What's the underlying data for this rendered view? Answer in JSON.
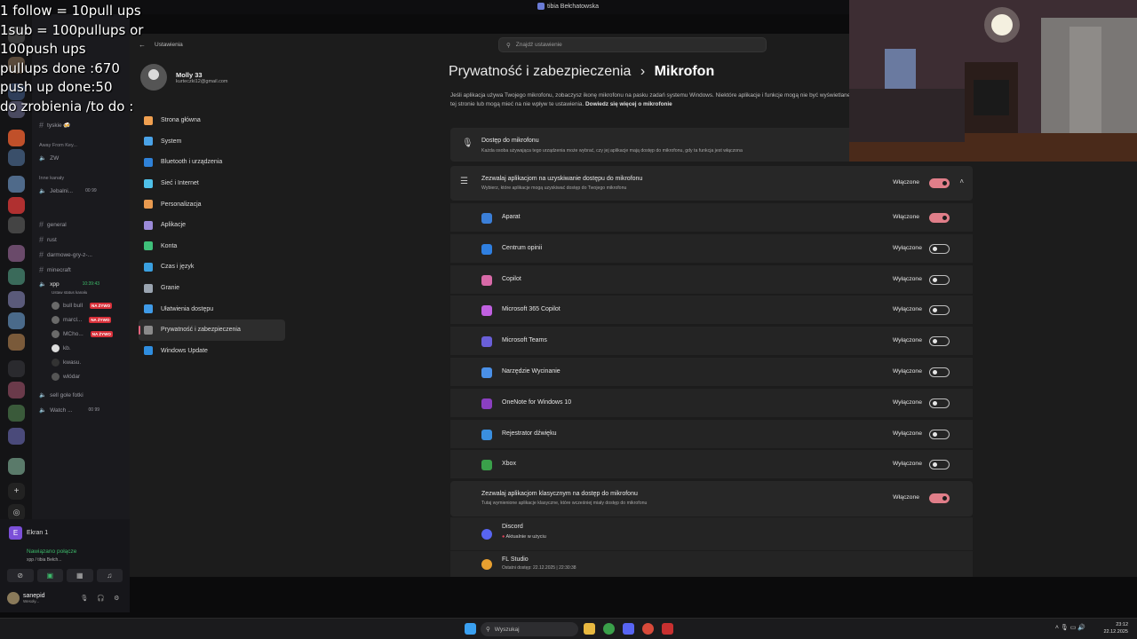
{
  "window_title": "tibia Bełchatowska",
  "overlay_lines": [
    "1 follow = 10pull ups",
    "1sub = 100pullups or",
    "100push ups",
    "pullups done :670",
    "push up done:50",
    "do zrobienia /to do :"
  ],
  "discord": {
    "channels": [
      {
        "label": "tyskie 🍻",
        "type": "text"
      },
      {
        "label": "Away From Key...",
        "type": "header"
      },
      {
        "label": "ZW",
        "type": "voice"
      },
      {
        "label": "Inne kanały",
        "type": "header"
      },
      {
        "label": "Jebalni...",
        "type": "voice",
        "extra": "00 99"
      },
      {
        "label": "general",
        "type": "text"
      },
      {
        "label": "rust",
        "type": "text"
      },
      {
        "label": "darmowe-gry-z-...",
        "type": "text"
      },
      {
        "label": "minecraft",
        "type": "text"
      },
      {
        "label": "xpp",
        "type": "voice",
        "extra": "10:39:43",
        "status": "Ustaw status kanału"
      },
      {
        "label": "sell gole fotki",
        "type": "voice"
      },
      {
        "label": "Watch ...",
        "type": "voice",
        "extra": "00 99"
      }
    ],
    "voice_users": [
      {
        "name": "bull bull",
        "live": "NA ŻYWO"
      },
      {
        "name": "marcl...",
        "live": "NA ŻYWO"
      },
      {
        "name": "MCho...",
        "live": "NA ŻYWO"
      },
      {
        "name": "kb.",
        "live": ""
      },
      {
        "name": "kwasu.",
        "live": ""
      },
      {
        "name": "wlódar",
        "live": ""
      }
    ],
    "screen_label": "Ekran 1",
    "screen_letter": "E",
    "connection_status": "Nawiązano połącze",
    "connection_sub": "xpp / tibia Bełch...",
    "username": "sanepid",
    "user_status": "Wesoły..."
  },
  "settings": {
    "app_title": "Ustawienia",
    "search_placeholder": "Znajdź ustawienie",
    "profile_name": "Molly 33",
    "profile_email": "kurteczki12@gmail.com",
    "nav": [
      {
        "label": "Strona główna",
        "color": "#f0a050"
      },
      {
        "label": "System",
        "color": "#4aa3e8"
      },
      {
        "label": "Bluetooth i urządzenia",
        "color": "#2f82d8"
      },
      {
        "label": "Sieć i Internet",
        "color": "#4fc0e8"
      },
      {
        "label": "Personalizacja",
        "color": "#e89a50"
      },
      {
        "label": "Aplikacje",
        "color": "#9b8ad8"
      },
      {
        "label": "Konta",
        "color": "#3fc07a"
      },
      {
        "label": "Czas i język",
        "color": "#3aa0e0"
      },
      {
        "label": "Granie",
        "color": "#9aa4b0"
      },
      {
        "label": "Ułatwienia dostępu",
        "color": "#3f9be8"
      },
      {
        "label": "Prywatność i zabezpieczenia",
        "color": "#8a8a8a",
        "active": true
      },
      {
        "label": "Windows Update",
        "color": "#2f8ee0"
      }
    ],
    "breadcrumb_parent": "Prywatność i zabezpieczenia",
    "breadcrumb_sep": "›",
    "breadcrumb_current": "Mikrofon",
    "description": "Jeśli aplikacja używa Twojego mikrofonu, zobaczysz ikonę mikrofonu na pasku zadań systemu Windows. Niektóre aplikacje i funkcje mogą nie być wyświetlane na tej stronie lub mogą mieć na nie wpływ te ustawienia.",
    "learn_more": "Dowiedz się więcej o mikrofonie",
    "access_title": "Dostęp do mikrofonu",
    "access_desc": "Każda osoba używająca tego urządzenia może wybrać, czy jej aplikacje mają dostęp do mikrofonu, gdy ta funkcja jest włączona",
    "allow_title": "Zezwalaj aplikacjom na uzyskiwanie dostępu do mikrofonu",
    "allow_desc": "Wybierz, które aplikacje mogą uzyskiwać dostęp do Twojego mikrofonu",
    "allow_state": "Włączone",
    "apps": [
      {
        "name": "Aparat",
        "state": "Włączone",
        "on": true,
        "color": "#3b7fd8"
      },
      {
        "name": "Centrum opinii",
        "state": "Wyłączone",
        "on": false,
        "color": "#2f7fe0"
      },
      {
        "name": "Copilot",
        "state": "Wyłączone",
        "on": false,
        "color": "#d86aa8"
      },
      {
        "name": "Microsoft 365 Copilot",
        "state": "Wyłączone",
        "on": false,
        "color": "#c060e0"
      },
      {
        "name": "Microsoft Teams",
        "state": "Wyłączone",
        "on": false,
        "color": "#6a5fd8"
      },
      {
        "name": "Narzędzie Wycinanie",
        "state": "Wyłączone",
        "on": false,
        "color": "#4a90e8"
      },
      {
        "name": "OneNote for Windows 10",
        "state": "Wyłączone",
        "on": false,
        "color": "#8a3fc0"
      },
      {
        "name": "Rejestrator dźwięku",
        "state": "Wyłączone",
        "on": false,
        "color": "#3a8fe0"
      },
      {
        "name": "Xbox",
        "state": "Wyłączone",
        "on": false,
        "color": "#3aa04a"
      }
    ],
    "classic_title": "Zezwalaj aplikacjom klasycznym na dostęp do mikrofonu",
    "classic_desc": "Tutaj wymienione aplikacje klasyczne, które wcześniej miały dostęp do mikrofonu",
    "classic_state": "Włączone",
    "classic_apps": [
      {
        "name": "Discord",
        "detail": "Aktualnie w użyciu",
        "color": "#5865f2"
      },
      {
        "name": "FL Studio",
        "detail": "Ostatni dostęp: 22.12.2025 | 22:30:38",
        "color": "#e8a030"
      }
    ]
  },
  "taskbar": {
    "search_label": "Wyszukaj",
    "time": "23:12",
    "date": "22.12.2025"
  }
}
